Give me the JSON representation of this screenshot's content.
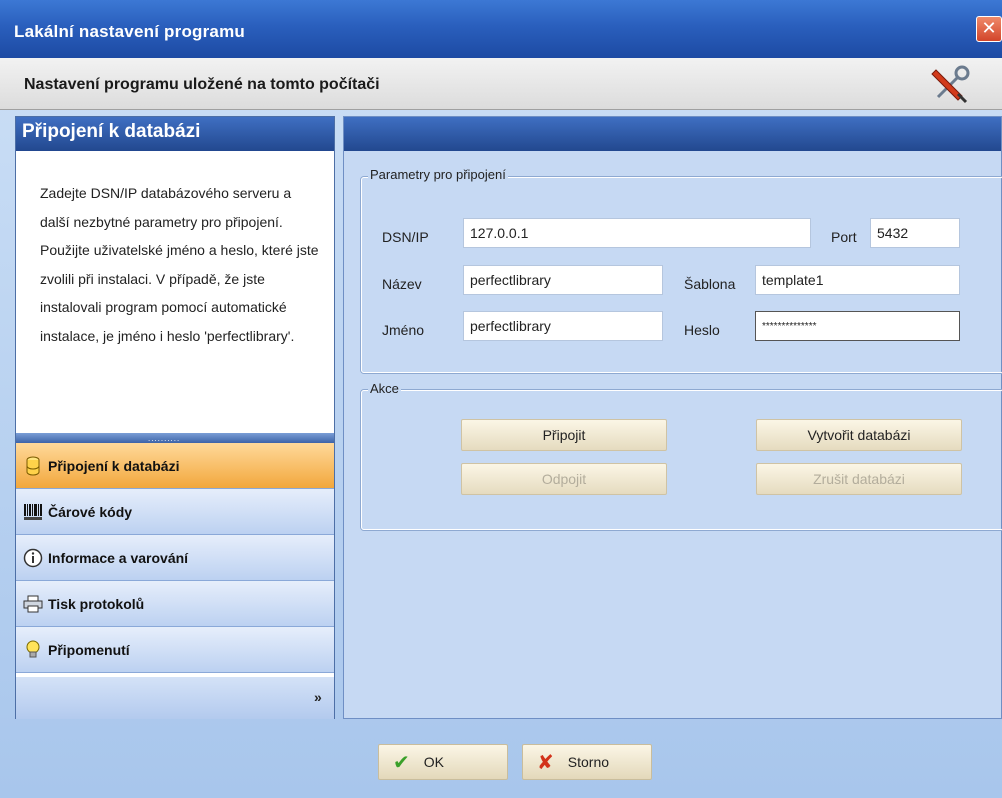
{
  "window": {
    "title": "Lakální nastavení programu",
    "close_symbol": "✕"
  },
  "header": {
    "text": "Nastavení programu uložené na tomto počítači",
    "icon": "tools-icon"
  },
  "sidebar": {
    "title": "Připojení k databázi",
    "description": "Zadejte DSN/IP databázového serveru a další nezbytné parametry pro připojení. Použijte uživatelské jméno a heslo, které jste zvolili při instalaci. V případě, že jste instalovali program pomocí automatické instalace, je jméno i heslo 'perfectlibrary'.",
    "splitter_dots": "..........",
    "items": [
      {
        "label": "Připojení k databázi",
        "icon": "database-icon",
        "active": true
      },
      {
        "label": "Čárové kódy",
        "icon": "barcode-icon",
        "active": false
      },
      {
        "label": "Informace a varování",
        "icon": "info-icon",
        "active": false
      },
      {
        "label": "Tisk protokolů",
        "icon": "printer-icon",
        "active": false
      },
      {
        "label": "Připomenutí",
        "icon": "lightbulb-icon",
        "active": false
      }
    ],
    "more_symbol": "»"
  },
  "connection": {
    "group_label": "Parametry pro připojení",
    "dsn_label": "DSN/IP",
    "dsn_value": "127.0.0.1",
    "port_label": "Port",
    "port_value": "5432",
    "name_label": "Název",
    "name_value": "perfectlibrary",
    "template_label": "Šablona",
    "template_value": "template1",
    "user_label": "Jméno",
    "user_value": "perfectlibrary",
    "password_label": "Heslo",
    "password_value": "**************"
  },
  "actions": {
    "group_label": "Akce",
    "connect": "Připojit",
    "disconnect": "Odpojit",
    "create_db": "Vytvořit databázi",
    "drop_db": "Zrušit databázi"
  },
  "dialog": {
    "ok": "OK",
    "cancel": "Storno"
  },
  "colors": {
    "accent": "#2a5fbd",
    "active_item": "#f2a73c",
    "panel_bg": "#c6d9f3"
  }
}
